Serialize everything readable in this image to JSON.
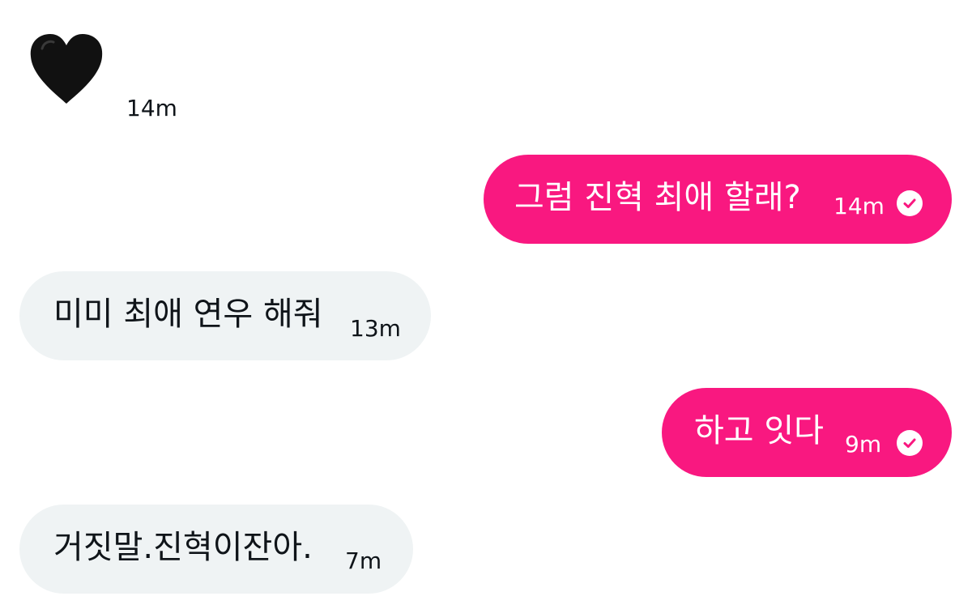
{
  "conversation": {
    "messages": [
      {
        "type": "emoji",
        "direction": "incoming",
        "emoji": "black-heart",
        "time": "14m"
      },
      {
        "type": "text",
        "direction": "outgoing",
        "text": "그럼 진혁 최애 할래?",
        "time": "14m",
        "status": "sent"
      },
      {
        "type": "text",
        "direction": "incoming",
        "text": "미미 최애 연우 해줘",
        "time": "13m"
      },
      {
        "type": "text",
        "direction": "outgoing",
        "text": "하고 잇다",
        "time": "9m",
        "status": "sent"
      },
      {
        "type": "text",
        "direction": "incoming",
        "text": "거짓말.진혁이잔아.",
        "time": "7m"
      }
    ]
  },
  "colors": {
    "outgoing_bubble": "#f91880",
    "incoming_bubble": "#eff3f4",
    "text_dark": "#0f1419",
    "text_light": "#ffffff"
  }
}
